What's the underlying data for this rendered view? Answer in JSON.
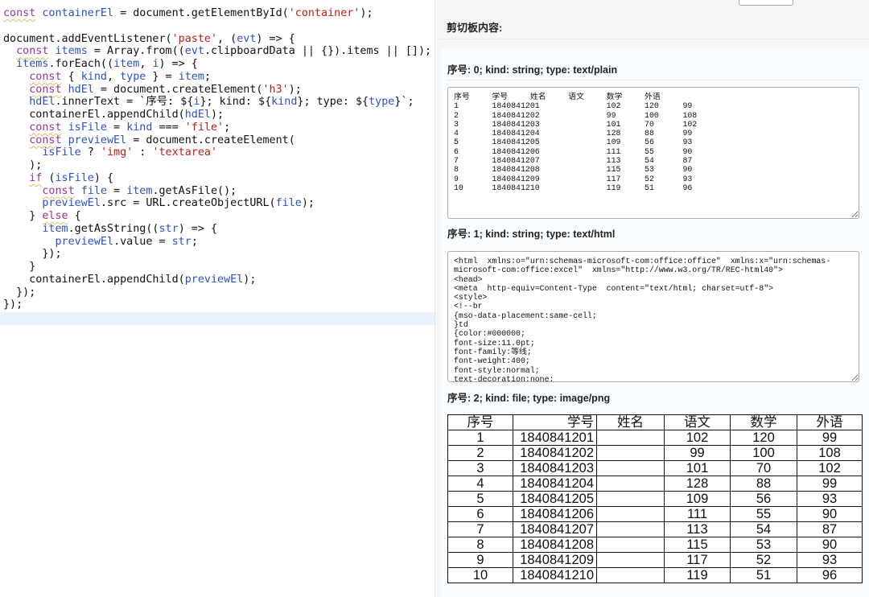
{
  "editor": {
    "lines": [
      [
        [
          "const",
          "kw"
        ],
        [
          " "
        ],
        [
          "containerEl",
          "var"
        ],
        [
          " = document.getElementById("
        ],
        [
          "'container'",
          "str"
        ],
        [
          ");"
        ]
      ],
      [],
      [
        [
          "document.addEventListener("
        ],
        [
          "'paste'",
          "str"
        ],
        [
          ", ("
        ],
        [
          "evt",
          "var"
        ],
        [
          ") => {"
        ]
      ],
      [
        [
          "  "
        ],
        [
          "const",
          "kw"
        ],
        [
          " "
        ],
        [
          "items",
          "var"
        ],
        [
          " = Array.from(("
        ],
        [
          "evt",
          "var"
        ],
        [
          ".clipboardData || {}).items || []);"
        ]
      ],
      [
        [
          "  "
        ],
        [
          "items",
          "var"
        ],
        [
          ".forEach(("
        ],
        [
          "item",
          "var"
        ],
        [
          ", "
        ],
        [
          "i",
          "var"
        ],
        [
          ") => {"
        ]
      ],
      [
        [
          "    "
        ],
        [
          "const",
          "kw"
        ],
        [
          " { "
        ],
        [
          "kind",
          "var"
        ],
        [
          ", "
        ],
        [
          "type",
          "var"
        ],
        [
          " } = "
        ],
        [
          "item",
          "var"
        ],
        [
          ";"
        ]
      ],
      [
        [
          "    "
        ],
        [
          "const",
          "kw"
        ],
        [
          " "
        ],
        [
          "hdEl",
          "var"
        ],
        [
          " = document.createElement("
        ],
        [
          "'h3'",
          "str"
        ],
        [
          ");"
        ]
      ],
      [
        [
          "    "
        ],
        [
          "hdEl",
          "var"
        ],
        [
          ".innerText = `序号: ${"
        ],
        [
          "i",
          "var"
        ],
        [
          "}; kind: ${"
        ],
        [
          "kind",
          "var"
        ],
        [
          "}; type: ${"
        ],
        [
          "type",
          "var"
        ],
        [
          "}`;"
        ]
      ],
      [
        [
          "    containerEl.appendChild("
        ],
        [
          "hdEl",
          "var"
        ],
        [
          ");"
        ]
      ],
      [
        [
          "    "
        ],
        [
          "const",
          "kw"
        ],
        [
          " "
        ],
        [
          "isFile",
          "var"
        ],
        [
          " = "
        ],
        [
          "kind",
          "var"
        ],
        [
          " === "
        ],
        [
          "'file'",
          "str"
        ],
        [
          ";"
        ]
      ],
      [
        [
          "    "
        ],
        [
          "const",
          "kw"
        ],
        [
          " "
        ],
        [
          "previewEl",
          "var"
        ],
        [
          " = document.createElement("
        ]
      ],
      [
        [
          "      "
        ],
        [
          "isFile",
          "var"
        ],
        [
          " ? "
        ],
        [
          "'img'",
          "str"
        ],
        [
          " : "
        ],
        [
          "'textarea'",
          "str"
        ]
      ],
      [
        [
          "    );"
        ]
      ],
      [
        [
          "    "
        ],
        [
          "if",
          "kw"
        ],
        [
          " ("
        ],
        [
          "isFile",
          "var"
        ],
        [
          ") {"
        ]
      ],
      [
        [
          "      "
        ],
        [
          "const",
          "kw"
        ],
        [
          " "
        ],
        [
          "file",
          "var"
        ],
        [
          " = "
        ],
        [
          "item",
          "var"
        ],
        [
          ".getAsFile();"
        ]
      ],
      [
        [
          "      "
        ],
        [
          "previewEl",
          "var"
        ],
        [
          ".src = URL.createObjectURL("
        ],
        [
          "file",
          "var"
        ],
        [
          ");"
        ]
      ],
      [
        [
          "    } "
        ],
        [
          "else",
          "kw"
        ],
        [
          " {"
        ]
      ],
      [
        [
          "      "
        ],
        [
          "item",
          "var"
        ],
        [
          ".getAsString(("
        ],
        [
          "str",
          "var"
        ],
        [
          ") => {"
        ]
      ],
      [
        [
          "        "
        ],
        [
          "previewEl",
          "var"
        ],
        [
          ".value = "
        ],
        [
          "str",
          "var"
        ],
        [
          ";"
        ]
      ],
      [
        [
          "      });"
        ]
      ],
      [
        [
          "    }"
        ]
      ],
      [
        [
          "    containerEl.appendChild("
        ],
        [
          "previewEl",
          "var"
        ],
        [
          ");"
        ]
      ],
      [
        [
          "  });"
        ]
      ],
      [
        [
          "});"
        ]
      ]
    ]
  },
  "clipboard": {
    "title": "剪切板内容:",
    "items": [
      {
        "heading": "序号: 0; kind: string; type: text/plain",
        "value": "序号\t学号\t姓名\t语文\t数学\t外语\n1\t1840841201\t\t102\t120\t99\n2\t1840841202\t\t99\t100\t108\n3\t1840841203\t\t101\t70\t102\n4\t1840841204\t\t128\t88\t99\n5\t1840841205\t\t109\t56\t93\n6\t1840841206\t\t111\t55\t90\n7\t1840841207\t\t113\t54\t87\n8\t1840841208\t\t115\t53\t90\n9\t1840841209\t\t117\t52\t93\n10\t1840841210\t\t119\t51\t96"
      },
      {
        "heading": "序号: 1; kind: string; type: text/html",
        "value": "<html  xmlns:o=\"urn:schemas-microsoft-com:office:office\"  xmlns:x=\"urn:schemas-microsoft-com:office:excel\"  xmlns=\"http://www.w3.org/TR/REC-html40\">\n<head>\n<meta  http-equiv=Content-Type  content=\"text/html; charset=utf-8\">\n<style>\n<!--br\n{mso-data-placement:same-cell;\n}td\n{color:#000000;\nfont-size:11.0pt;\nfont-family:等线;\nfont-weight:400;\nfont-style:normal;\ntext-decoration:none;"
      },
      {
        "heading": "序号: 2; kind: file; type: image/png"
      }
    ],
    "image_table": {
      "headers": [
        "序号",
        "学号",
        "姓名",
        "语文",
        "数学",
        "外语"
      ],
      "rows": [
        [
          "1",
          "1840841201",
          "",
          "102",
          "120",
          "99"
        ],
        [
          "2",
          "1840841202",
          "",
          "99",
          "100",
          "108"
        ],
        [
          "3",
          "1840841203",
          "",
          "101",
          "70",
          "102"
        ],
        [
          "4",
          "1840841204",
          "",
          "128",
          "88",
          "99"
        ],
        [
          "5",
          "1840841205",
          "",
          "109",
          "56",
          "93"
        ],
        [
          "6",
          "1840841206",
          "",
          "111",
          "55",
          "90"
        ],
        [
          "7",
          "1840841207",
          "",
          "113",
          "54",
          "87"
        ],
        [
          "8",
          "1840841208",
          "",
          "115",
          "53",
          "90"
        ],
        [
          "9",
          "1840841209",
          "",
          "117",
          "52",
          "93"
        ],
        [
          "10",
          "1840841210",
          "",
          "119",
          "51",
          "96"
        ]
      ]
    }
  }
}
